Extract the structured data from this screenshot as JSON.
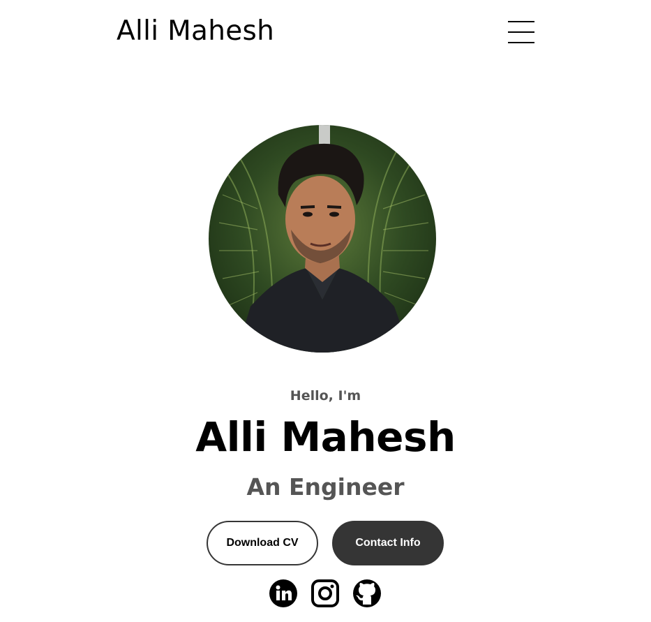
{
  "nav": {
    "logo": "Alli Mahesh",
    "menu_icon": "hamburger-menu-icon"
  },
  "profile": {
    "image": "profile-photo",
    "greeting": "Hello, I'm",
    "name": "Alli Mahesh",
    "title": "An Engineer"
  },
  "buttons": {
    "download_cv": "Download CV",
    "contact_info": "Contact Info"
  },
  "socials": [
    {
      "icon": "linkedin-icon"
    },
    {
      "icon": "instagram-icon"
    },
    {
      "icon": "github-icon"
    }
  ],
  "colors": {
    "text": "#000000",
    "muted": "#555555",
    "button_dark": "#353535",
    "background": "#ffffff"
  }
}
